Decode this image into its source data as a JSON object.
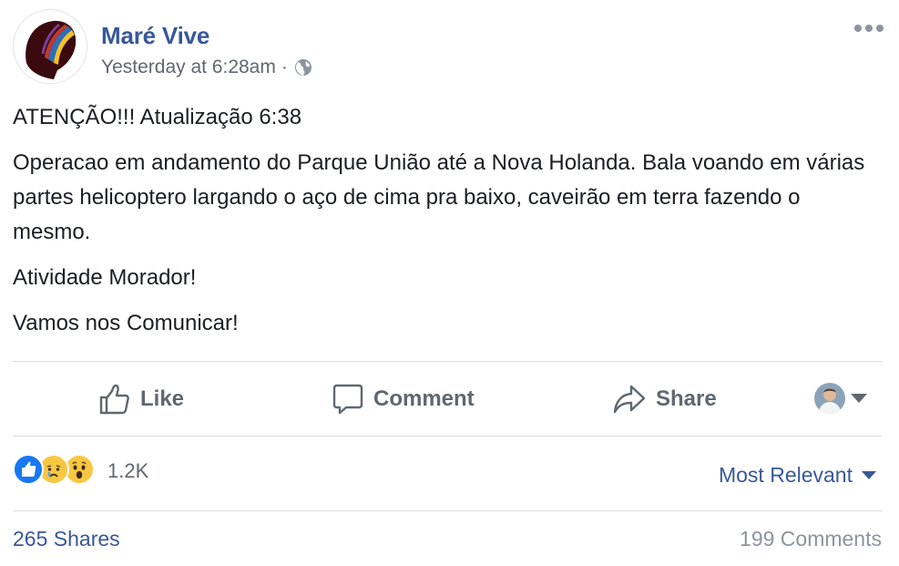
{
  "post": {
    "author": "Maré Vive",
    "timestamp": "Yesterday at 6:28am",
    "separator": "·",
    "privacy_icon": "globe-icon",
    "paragraphs": [
      "ATENÇÃO!!! Atualização 6:38",
      "Operacao em andamento do Parque União até a Nova Holanda. Bala voando em várias partes helicoptero largando o aço de cima pra baixo, caveirão em terra fazendo o mesmo.",
      "Atividade Morador!",
      "Vamos nos Comunicar!"
    ]
  },
  "actions": {
    "like": "Like",
    "comment": "Comment",
    "share": "Share"
  },
  "reactions": {
    "types": [
      "like",
      "sad",
      "wow"
    ],
    "count": "1.2K",
    "sort_label": "Most Relevant"
  },
  "footer": {
    "shares": "265 Shares",
    "comments": "199 Comments"
  },
  "colors": {
    "brand_link": "#385898",
    "secondary_text": "#606770",
    "like_blue": "#1877f2",
    "emoji_yellow": "#f7c744"
  }
}
